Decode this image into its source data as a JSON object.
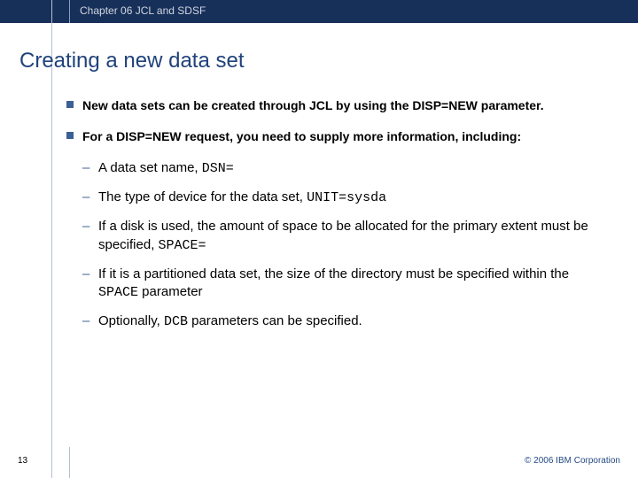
{
  "header": {
    "chapter": "Chapter 06 JCL and SDSF"
  },
  "title": "Creating a new data set",
  "bullets": [
    {
      "strong1": "New data sets can be created through JCL by using the DISP=NEW parameter."
    },
    {
      "strong1": "For a DISP=NEW request, you need to supply more information, including:"
    }
  ],
  "subs": [
    {
      "pre": "A data set name, ",
      "code": "DSN=",
      "post": ""
    },
    {
      "pre": "The type of device for the data set, ",
      "code": "UNIT=sysda",
      "post": ""
    },
    {
      "pre": "If a disk is used, the amount of space to be allocated for the primary extent must be specified, ",
      "code": "SPACE=",
      "post": ""
    },
    {
      "pre": "If it is a partitioned data set, the size of the directory must be specified within the ",
      "code": "SPACE",
      "post": " parameter"
    },
    {
      "pre": "Optionally, ",
      "code": "DCB",
      "post": " parameters can be specified."
    }
  ],
  "footer": {
    "page": "13",
    "copyright": "© 2006 IBM Corporation"
  }
}
